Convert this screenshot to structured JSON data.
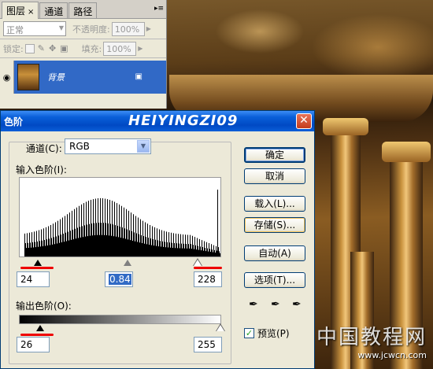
{
  "layers_panel": {
    "tabs": [
      {
        "label": "图层",
        "close": "×"
      },
      {
        "label": "通道"
      },
      {
        "label": "路径"
      }
    ],
    "blend_mode": "正常",
    "opacity_label": "不透明度:",
    "opacity_value": "100%",
    "lock_label": "锁定:",
    "fill_label": "填充:",
    "fill_value": "100%",
    "layer_name": "背景"
  },
  "dialog": {
    "title": "色阶",
    "brand_text": "HEIYINGZI09",
    "close_glyph": "✕",
    "channel_label": "通道(C):",
    "channel_value": "RGB",
    "input_levels_label": "输入色阶(I):",
    "input_black": "24",
    "input_gamma": "0.84",
    "input_white": "228",
    "output_levels_label": "输出色阶(O):",
    "output_black": "26",
    "output_white": "255",
    "buttons": {
      "ok": "确定",
      "cancel": "取消",
      "load": "载入(L)...",
      "save": "存储(S)...",
      "auto": "自动(A)",
      "options": "选项(T)..."
    },
    "preview_label": "预览(P)",
    "preview_checked": true
  },
  "watermark": {
    "text": "中国教程网",
    "url": "www.jcwcn.com"
  },
  "colors": {
    "titlebar": "#0a5fd8",
    "selection": "#316ac5",
    "annotation_red": "#e00000"
  }
}
